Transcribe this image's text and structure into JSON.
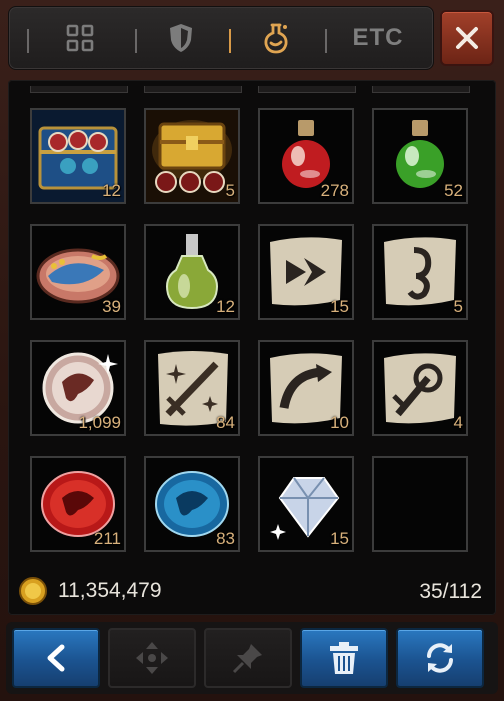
{
  "tabs": [
    {
      "name": "all-items",
      "icon": "grid-icon",
      "active": false
    },
    {
      "name": "equipment",
      "icon": "shield-icon",
      "active": false
    },
    {
      "name": "consumables",
      "icon": "potion-icon",
      "active": true
    },
    {
      "name": "etc",
      "label": "ETC",
      "active": false
    }
  ],
  "close_icon": "close-icon",
  "slots": [
    {
      "icon": "treasure-chest-blue-icon",
      "qty": "12"
    },
    {
      "icon": "treasure-chest-gold-icon",
      "qty": "5"
    },
    {
      "icon": "red-potion-icon",
      "qty": "278"
    },
    {
      "icon": "green-potion-icon",
      "qty": "52"
    },
    {
      "icon": "fish-dish-icon",
      "qty": "39"
    },
    {
      "icon": "elixir-bottle-icon",
      "qty": "12"
    },
    {
      "icon": "scroll-arrow-icon",
      "qty": "15"
    },
    {
      "icon": "scroll-rune-icon",
      "qty": "5"
    },
    {
      "icon": "dragon-orb-icon",
      "qty": "1,099"
    },
    {
      "icon": "scroll-sword-icon",
      "qty": "84"
    },
    {
      "icon": "scroll-curve-icon",
      "qty": "10"
    },
    {
      "icon": "scroll-target-icon",
      "qty": "4"
    },
    {
      "icon": "red-dragon-stone-icon",
      "qty": "211"
    },
    {
      "icon": "blue-dragon-stone-icon",
      "qty": "83"
    },
    {
      "icon": "white-diamond-icon",
      "qty": "15"
    },
    {
      "icon": "",
      "qty": ""
    }
  ],
  "footer": {
    "gold": "11,354,479",
    "capacity": "35/112",
    "gold_icon": "gold-coin-icon"
  },
  "actions": [
    {
      "name": "back-button",
      "icon": "chevron-left-icon",
      "style": "blue"
    },
    {
      "name": "move-button",
      "icon": "move-arrows-icon",
      "style": "gray"
    },
    {
      "name": "pin-button",
      "icon": "pin-icon",
      "style": "gray"
    },
    {
      "name": "discard-button",
      "icon": "trash-icon",
      "style": "blue"
    },
    {
      "name": "refresh-button",
      "icon": "refresh-icon",
      "style": "blue"
    }
  ],
  "colors": {
    "accent": "#d89a48",
    "qty": "#d8b17c",
    "button_blue": "#1b5390",
    "close_red": "#8a3020"
  }
}
